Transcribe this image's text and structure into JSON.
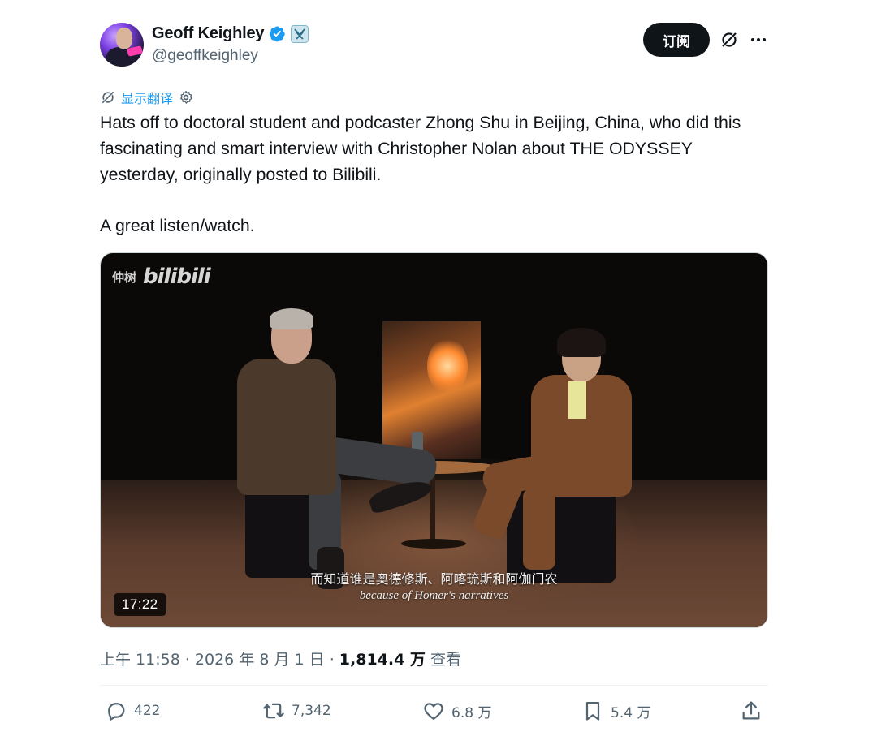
{
  "author": {
    "display_name": "Geoff Keighley",
    "handle": "@geoffkeighley",
    "verified_icon": "verified-badge-icon",
    "affiliate_icon": "affiliate-badge-icon"
  },
  "header": {
    "subscribe_label": "订阅",
    "grok_icon": "grok-icon",
    "more_icon": "more-icon"
  },
  "translate": {
    "label": "显示翻译"
  },
  "tweet": {
    "text": "Hats off to doctoral student and podcaster Zhong Shu in Beijing, China, who did this fascinating and smart interview with Christopher Nolan about THE ODYSSEY yesterday, originally posted to Bilibili.\n\nA great listen/watch."
  },
  "media": {
    "watermark_cn": "仲树",
    "watermark_logo": "bilibili",
    "subtitle_cn": "而知道谁是奥德修斯、阿喀琉斯和阿伽门农",
    "subtitle_en": "because of Homer's narratives",
    "duration": "17:22"
  },
  "meta": {
    "time": "上午 11:58",
    "sep1": " · ",
    "date": "2026 年 8 月 1 日",
    "sep2": " · ",
    "views": "1,814.4 万",
    "views_suffix": " 查看"
  },
  "actions": {
    "replies": "422",
    "reposts": "7,342",
    "likes": "6.8 万",
    "bookmarks": "5.4 万"
  },
  "colors": {
    "accent": "#1d9bf0",
    "text_primary": "#0f1419",
    "text_secondary": "#536471",
    "button_dark": "#0f1419"
  }
}
